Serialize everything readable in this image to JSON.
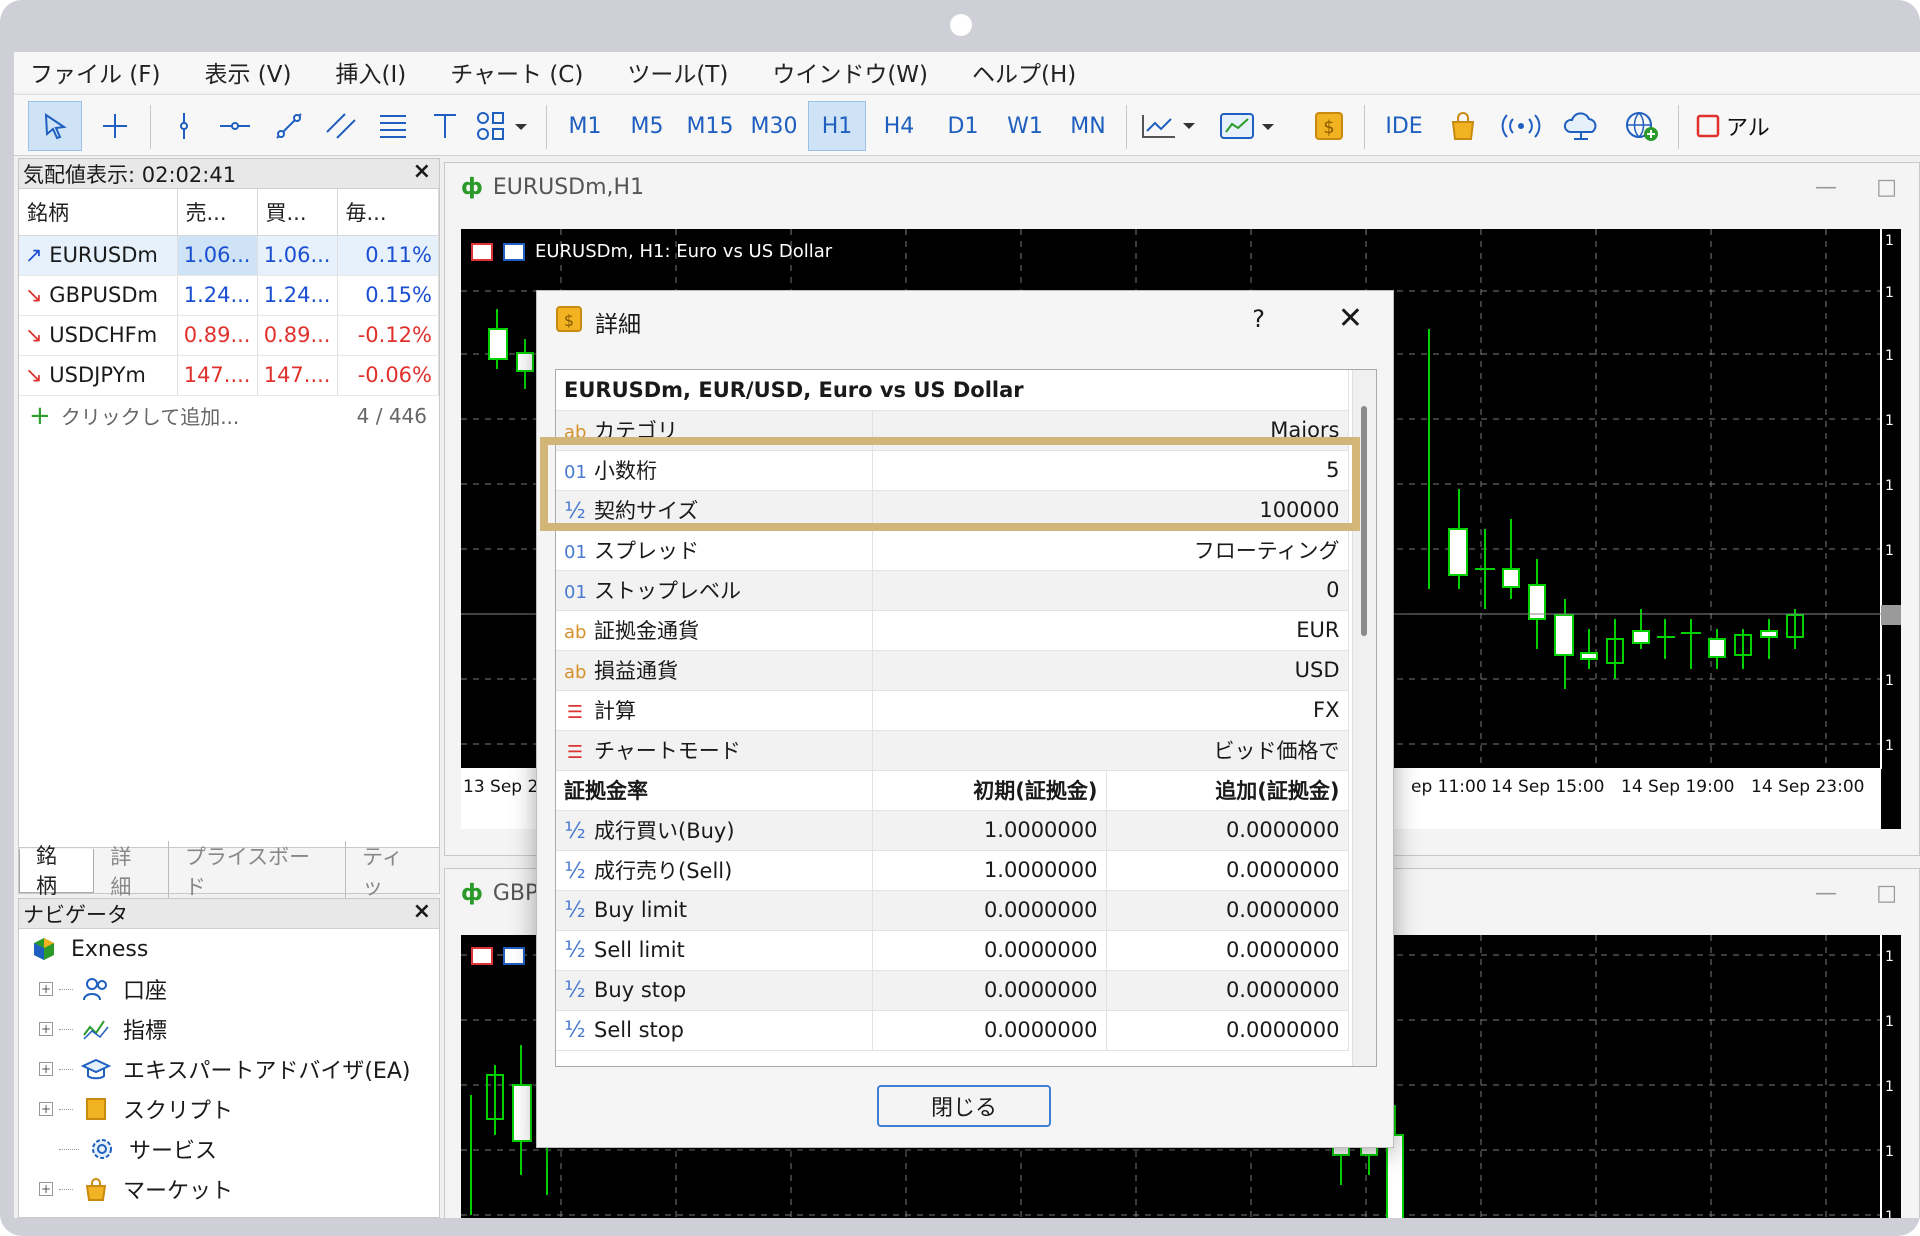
{
  "menu": [
    "ファイル (F)",
    "表示 (V)",
    "挿入(I)",
    "チャート (C)",
    "ツール(T)",
    "ウインドウ(W)",
    "ヘルプ(H)"
  ],
  "timeframes": [
    "M1",
    "M5",
    "M15",
    "M30",
    "H1",
    "H4",
    "D1",
    "W1",
    "MN"
  ],
  "active_timeframe": "H1",
  "toolbar_text": {
    "ide": "IDE",
    "truncated": "アル"
  },
  "market_watch": {
    "title": "気配値表示: 02:02:41",
    "columns": [
      "銘柄",
      "売...",
      "買...",
      "毎..."
    ],
    "rows": [
      {
        "symbol": "EURUSDm",
        "bid": "1.06...",
        "ask": "1.06...",
        "change": "0.11%",
        "dir": "up"
      },
      {
        "symbol": "GBPUSDm",
        "bid": "1.24...",
        "ask": "1.24...",
        "change": "0.15%",
        "dir": "down"
      },
      {
        "symbol": "USDCHFm",
        "bid": "0.89...",
        "ask": "0.89...",
        "change": "-0.12%",
        "dir": "down"
      },
      {
        "symbol": "USDJPYm",
        "bid": "147....",
        "ask": "147....",
        "change": "-0.06%",
        "dir": "down"
      }
    ],
    "add_label": "クリックして追加...",
    "count": "4 / 446",
    "tabs": [
      "銘柄",
      "詳細",
      "プライスボード",
      "ティッ"
    ]
  },
  "navigator": {
    "title": "ナビゲータ",
    "root": "Exness",
    "items": [
      "口座",
      "指標",
      "エキスパートアドバイザ(EA)",
      "スクリプト",
      "サービス",
      "マーケット"
    ]
  },
  "chart1": {
    "tab": "EURUSDm,H1",
    "title": "EURUSDm, H1:  Euro vs US Dollar",
    "time_labels": [
      "13 Sep 2",
      "ep 11:00",
      "14 Sep 15:00",
      "14 Sep 19:00",
      "14 Sep 23:00"
    ]
  },
  "chart2": {
    "tab": "GBP"
  },
  "dialog": {
    "title": "詳細",
    "help": "?",
    "header": "EURUSDm, EUR/USD, Euro vs US Dollar",
    "rows": [
      {
        "icon": "ab",
        "label": "カテゴリ",
        "value": "Majors"
      },
      {
        "icon": "01",
        "label": "小数桁",
        "value": "5"
      },
      {
        "icon": "half",
        "label": "契約サイズ",
        "value": "100000"
      },
      {
        "icon": "01",
        "label": "スプレッド",
        "value": "フローティング"
      },
      {
        "icon": "01",
        "label": "ストップレベル",
        "value": "0"
      },
      {
        "icon": "ab",
        "label": "証拠金通貨",
        "value": "EUR"
      },
      {
        "icon": "ab",
        "label": "損益通貨",
        "value": "USD"
      },
      {
        "icon": "list",
        "label": "計算",
        "value": "FX"
      },
      {
        "icon": "list",
        "label": "チャートモード",
        "value": "ビッド価格で"
      }
    ],
    "margin_header": {
      "label": "証拠金率",
      "initial": "初期(証拠金)",
      "maintenance": "追加(証拠金)"
    },
    "margin_rows": [
      {
        "label": "成行買い(Buy)",
        "initial": "1.0000000",
        "maintenance": "0.0000000"
      },
      {
        "label": "成行売り(Sell)",
        "initial": "1.0000000",
        "maintenance": "0.0000000"
      },
      {
        "label": "Buy limit",
        "initial": "0.0000000",
        "maintenance": "0.0000000"
      },
      {
        "label": "Sell limit",
        "initial": "0.0000000",
        "maintenance": "0.0000000"
      },
      {
        "label": "Buy stop",
        "initial": "0.0000000",
        "maintenance": "0.0000000"
      },
      {
        "label": "Sell stop",
        "initial": "0.0000000",
        "maintenance": "0.0000000"
      }
    ],
    "close_label": "閉じる"
  },
  "colors": {
    "highlight": "#d2b679",
    "up": "#1a4fd1",
    "down": "#e0312c",
    "candle_up": "#00d000"
  }
}
